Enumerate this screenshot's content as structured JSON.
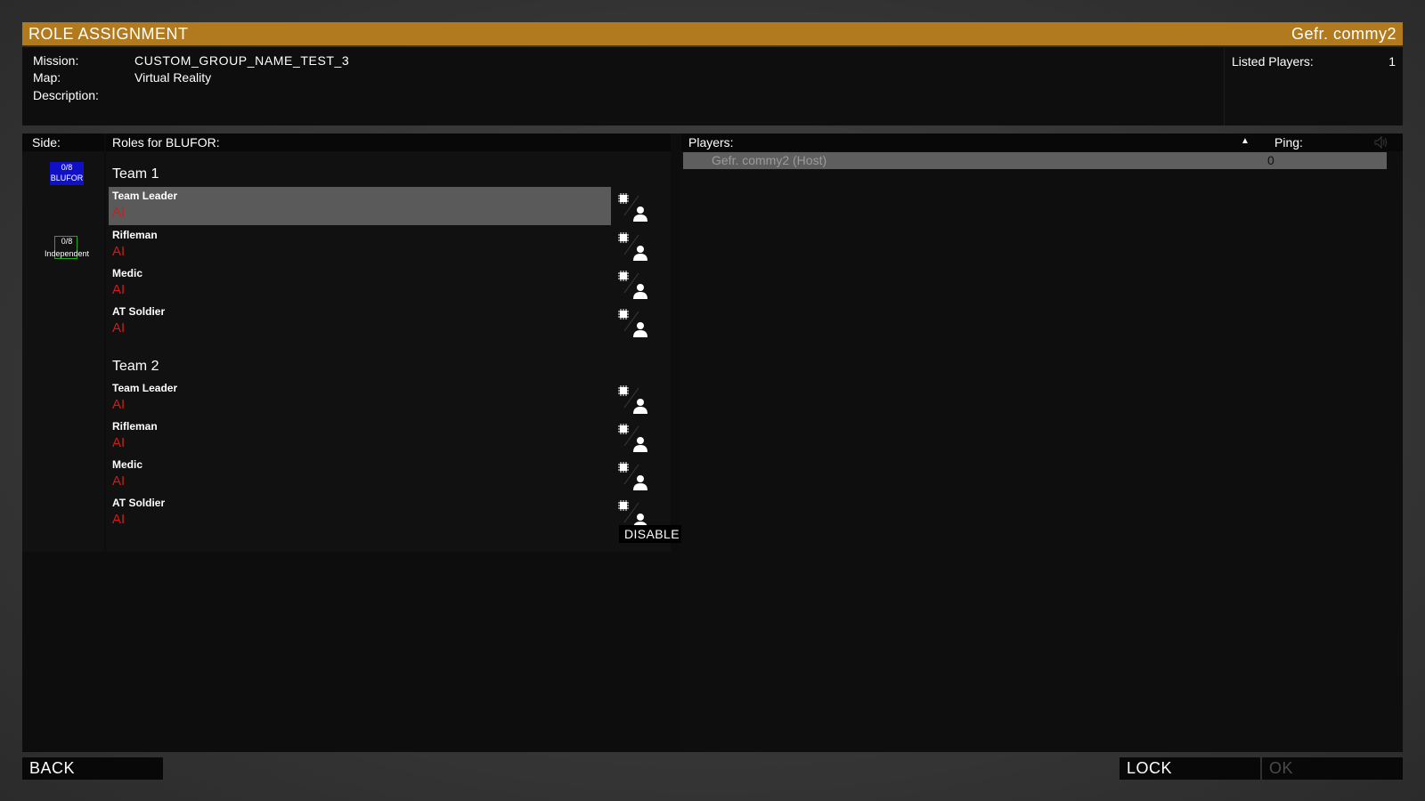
{
  "header": {
    "title": "ROLE ASSIGNMENT",
    "user": "Gefr. commy2"
  },
  "info": {
    "mission_label": "Mission:",
    "mission_value": "CUSTOM_GROUP_NAME_TEST_3",
    "map_label": "Map:",
    "map_value": "Virtual Reality",
    "description_label": "Description:",
    "listed_label": "Listed Players:",
    "listed_value": "1"
  },
  "sides": {
    "header": "Side:",
    "items": [
      {
        "count": "0/8",
        "name": "BLUFOR",
        "color": "#1010c8"
      },
      {
        "count": "0/8",
        "name": "Independent",
        "color": "#22aa22"
      }
    ]
  },
  "roles": {
    "header": "Roles for BLUFOR:",
    "teams": [
      {
        "title": "Team 1",
        "roles": [
          {
            "name": "Team Leader",
            "slot": "AI"
          },
          {
            "name": "Rifleman",
            "slot": "AI"
          },
          {
            "name": "Medic",
            "slot": "AI"
          },
          {
            "name": "AT Soldier",
            "slot": "AI"
          }
        ]
      },
      {
        "title": "Team 2",
        "roles": [
          {
            "name": "Team Leader",
            "slot": "AI"
          },
          {
            "name": "Rifleman",
            "slot": "AI"
          },
          {
            "name": "Medic",
            "slot": "AI"
          },
          {
            "name": "AT Soldier",
            "slot": "AI"
          }
        ]
      }
    ],
    "selected": "Team 1 / Team Leader",
    "disable_ai_label": "DISABLE AI",
    "slot_color": "#d21a1a"
  },
  "players": {
    "header": "Players:",
    "ping_header": "Ping:",
    "rows": [
      {
        "name": "Gefr. commy2 (Host)",
        "ping": "0"
      }
    ]
  },
  "footer": {
    "back": "BACK",
    "lock": "LOCK",
    "ok": "OK"
  },
  "icons": [
    "ai-chip-icon",
    "player-silhouette-icon",
    "speaker-icon",
    "sort-ascending-icon",
    "scroll-up-icon",
    "scroll-down-icon"
  ]
}
